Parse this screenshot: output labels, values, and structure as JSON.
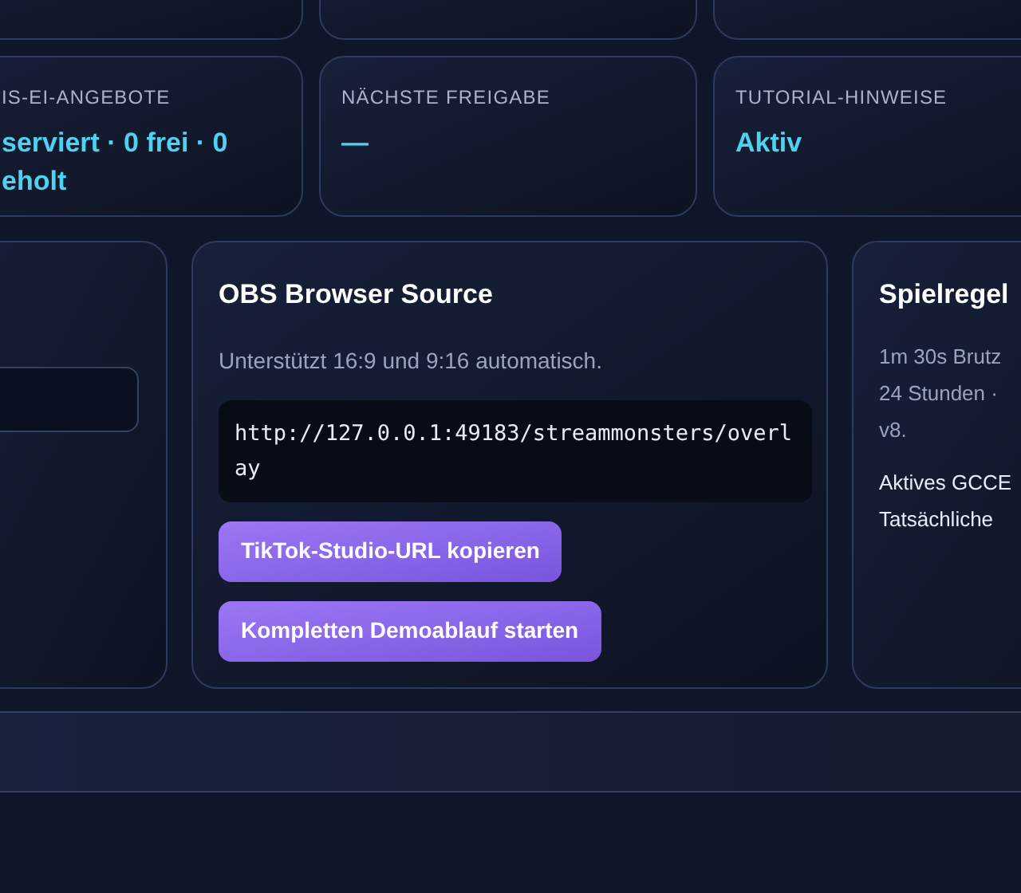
{
  "stats": [
    {
      "label": "IS-EI-ANGEBOTE",
      "value": [
        "serviert · 0 frei · 0",
        "eholt"
      ]
    },
    {
      "label": "NÄCHSTE FREIGABE",
      "value": [
        "—"
      ]
    },
    {
      "label": "TUTORIAL-HINWEISE",
      "value": [
        "Aktiv"
      ]
    }
  ],
  "obs": {
    "title": "OBS Browser Source",
    "note": "Unterstützt 16:9 und 9:16 automatisch.",
    "url": "http://127.0.0.1:49183/streammonsters/overlay",
    "buttons": [
      "TikTok-Studio-URL kopieren",
      "Kompletten Demoablauf starten"
    ]
  },
  "rules": {
    "title": "Spielregel",
    "paragraphs": [
      [
        "1m 30s Brutz",
        "24 Stunden ·",
        "v8."
      ],
      [
        "Aktives GCCE",
        "Tatsächliche"
      ]
    ]
  }
}
